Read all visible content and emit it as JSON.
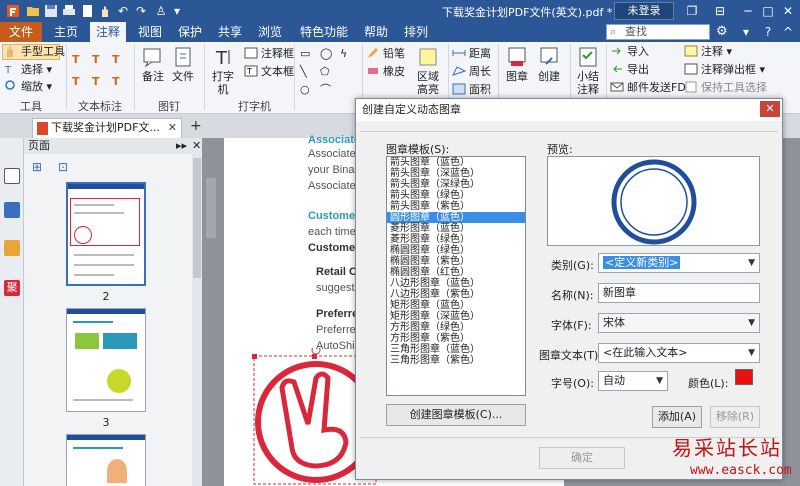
{
  "titlebar": {
    "title": "下载奖金计划PDF文件(英文).pdf * - ...",
    "login": "未登录"
  },
  "menu_tabs": [
    {
      "label": "文件"
    },
    {
      "label": "主页"
    },
    {
      "label": "注释"
    },
    {
      "label": "视图"
    },
    {
      "label": "保护"
    },
    {
      "label": "共享"
    },
    {
      "label": "浏览"
    },
    {
      "label": "特色功能"
    },
    {
      "label": "帮助"
    },
    {
      "label": "排列"
    }
  ],
  "context_tab": "排列",
  "search": {
    "placeholder": "查找"
  },
  "ribbon": {
    "tools": {
      "hand": "手型工具",
      "select": "选择",
      "zoom": "缩放",
      "group": "工具"
    },
    "text_markup": {
      "group": "文本标注"
    },
    "pin": {
      "note": "备注",
      "file": "文件",
      "group": "图钉"
    },
    "typewriter": {
      "type": "打字机",
      "callout": "注释框",
      "textbox": "文本框",
      "group": "打字机"
    },
    "drawing": {
      "pencil": "铅笔",
      "eraser": "橡皮",
      "area_highlight": "区域高亮"
    },
    "measure": {
      "distance": "距离",
      "perimeter": "周长",
      "area": "面积"
    },
    "stamp": {
      "stamp": "图章",
      "create": "创建"
    },
    "summary": {
      "label": "小结注释"
    },
    "manage": {
      "import": "导入",
      "export": "导出",
      "email_fdf": "邮件发送FDF",
      "annotation": "注释",
      "popup": "注释弹出框",
      "keep_selected": "保持工具选择"
    }
  },
  "doc_tab": {
    "label": "下载奖金计划PDF文..."
  },
  "thumb_panel": {
    "title": "页面",
    "pages": [
      {
        "num": "2"
      },
      {
        "num": "3"
      }
    ]
  },
  "document": {
    "lines": [
      {
        "text": "Associate",
        "style": "teal"
      },
      {
        "text": "Associate",
        "style": "normal"
      },
      {
        "text": "your Bina",
        "style": "normal"
      },
      {
        "text": "Associate",
        "style": "normal"
      },
      {
        "text": "Custome",
        "style": "teal"
      },
      {
        "text": "each time",
        "style": "normal"
      },
      {
        "text": "Custome",
        "style": "bold"
      },
      {
        "text": "Retail C",
        "style": "bold"
      },
      {
        "text": "suggest",
        "style": "normal"
      },
      {
        "text": "Preferre",
        "style": "bold"
      },
      {
        "text": "Preferre",
        "style": "normal"
      },
      {
        "text": "AutoShi",
        "style": "normal"
      }
    ]
  },
  "dialog": {
    "title": "创建自定义动态图章",
    "template_label": "图章模板(S):",
    "preview_label": "预览:",
    "templates": [
      "箭头图章（蓝色）",
      "箭头图章（深蓝色）",
      "箭头图章（深绿色）",
      "箭头图章（绿色）",
      "箭头图章（紫色）",
      "圆形图章（蓝色）",
      "菱形图章（蓝色）",
      "菱形图章（绿色）",
      "椭圆图章（绿色）",
      "椭圆图章（紫色）",
      "椭圆图章（红色）",
      "八边形图章（蓝色）",
      "八边形图章（紫色）",
      "矩形图章（蓝色）",
      "矩形图章（深蓝色）",
      "方形图章（绿色）",
      "方形图章（紫色）",
      "三角形图章（蓝色）",
      "三角形图章（紫色）"
    ],
    "selected_index": 5,
    "create_template_btn": "创建图章模板(C)...",
    "category_label": "类别(G):",
    "category_value": "<定义新类别>",
    "name_label": "名称(N):",
    "name_value": "新图章",
    "font_label": "字体(F):",
    "font_value": "宋体",
    "stamp_text_label": "图章文本(T)",
    "stamp_text_value": "<在此输入文本>",
    "size_label": "字号(O):",
    "size_value": "自动",
    "color_label": "颜色(L):",
    "stamp_color": "#e81010",
    "add_btn": "添加(A)",
    "remove_btn": "移除(R)",
    "ok_btn": "确定"
  },
  "watermark": {
    "cn": "易采站长站",
    "url": "www.easck.com"
  },
  "colors": {
    "brand": "#2b5797",
    "file_tab": "#c85c1b",
    "stamp_ring": "#1f4f9a",
    "page_stamp": "#d8283a"
  }
}
